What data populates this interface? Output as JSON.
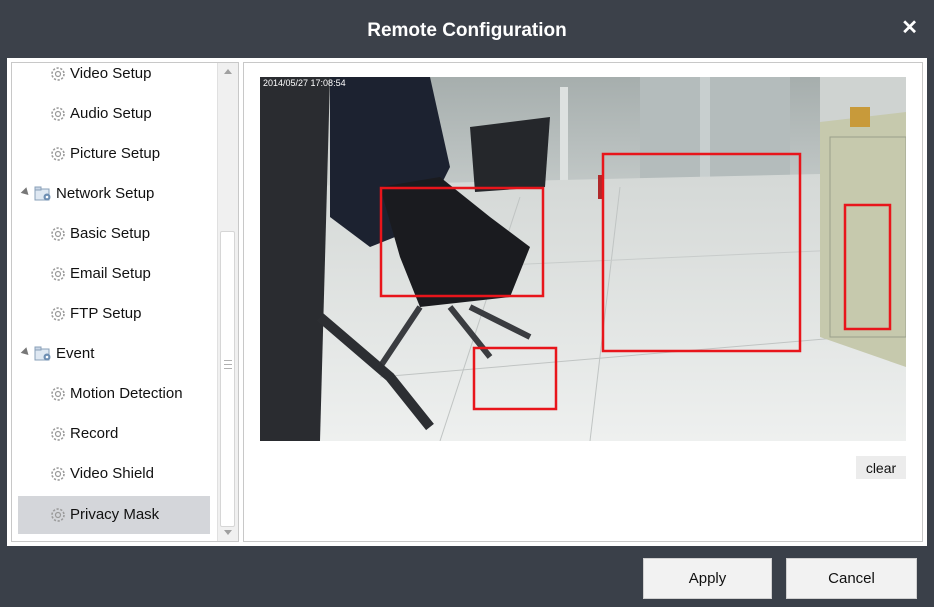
{
  "window": {
    "title": "Remote Configuration"
  },
  "tree": {
    "items": [
      {
        "label": "Video Setup",
        "type": "leaf"
      },
      {
        "label": "Audio Setup",
        "type": "leaf"
      },
      {
        "label": "Picture Setup",
        "type": "leaf"
      },
      {
        "label": "Network Setup",
        "type": "folder"
      },
      {
        "label": "Basic Setup",
        "type": "leaf"
      },
      {
        "label": "Email Setup",
        "type": "leaf"
      },
      {
        "label": "FTP Setup",
        "type": "leaf"
      },
      {
        "label": "Event",
        "type": "folder"
      },
      {
        "label": "Motion Detection",
        "type": "leaf"
      },
      {
        "label": "Record",
        "type": "leaf"
      },
      {
        "label": "Video Shield",
        "type": "leaf"
      },
      {
        "label": "Privacy Mask",
        "type": "leaf",
        "selected": true
      }
    ]
  },
  "preview": {
    "timestamp": "2014/05/27 17:08:54",
    "mask_color": "#e8151b"
  },
  "buttons": {
    "clear": "clear",
    "apply": "Apply",
    "cancel": "Cancel"
  },
  "icons": {
    "close": "close-icon",
    "gear": "gear-icon",
    "folder": "network-folder-icon",
    "expand": "expand-arrow-icon"
  }
}
